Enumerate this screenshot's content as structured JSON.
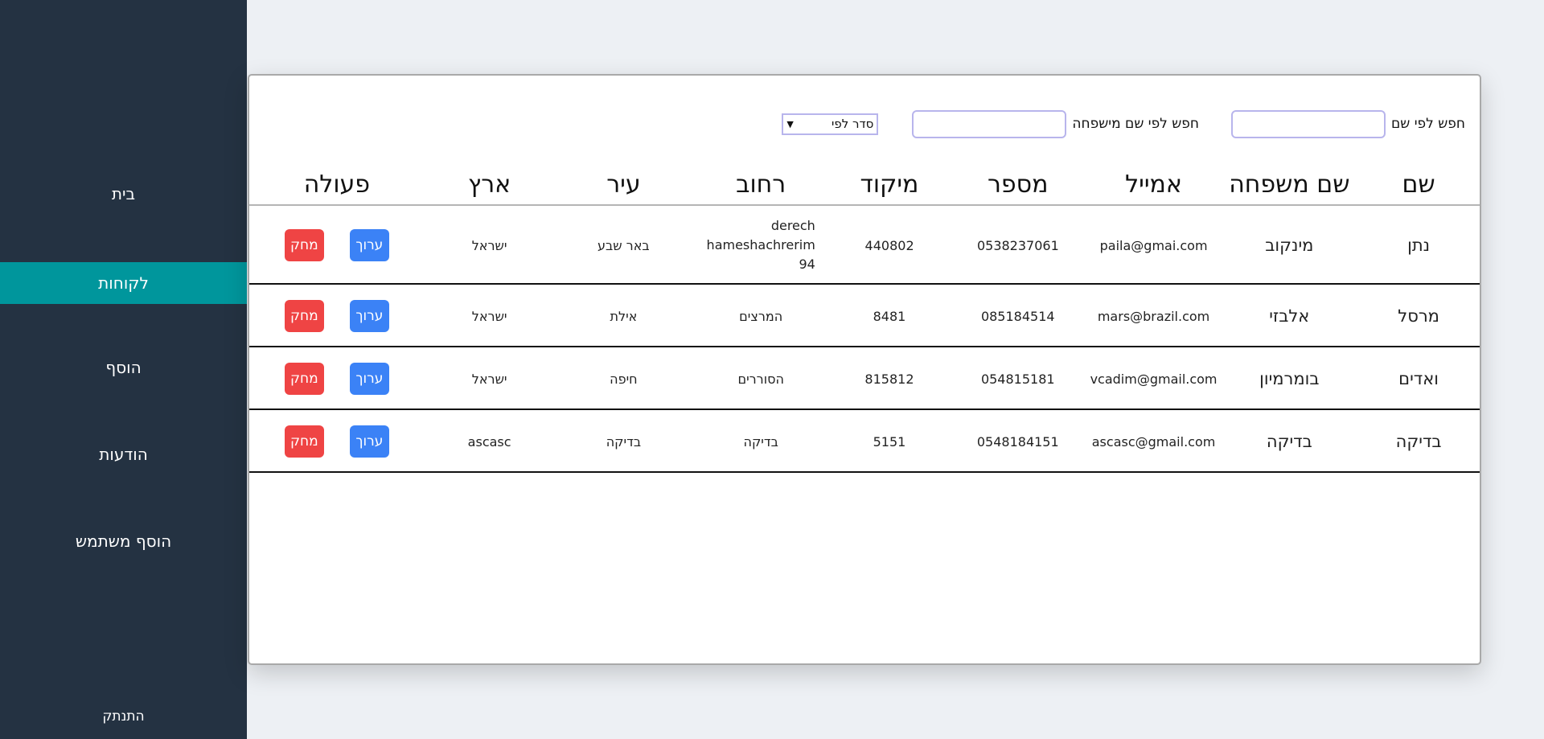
{
  "sidebar": {
    "items": [
      {
        "label": "בית"
      },
      {
        "label": "לקוחות"
      },
      {
        "label": "הוסף"
      },
      {
        "label": "הודעות"
      },
      {
        "label": "הוסף משתמש"
      }
    ],
    "active_index": 1,
    "logout_label": "התנתק"
  },
  "filters": {
    "first_name_label": "חפש לפי שם",
    "first_name_value": "",
    "last_name_label": "חפש לפי שם מישפחה",
    "last_name_value": "",
    "sort_label": "סדר לפי"
  },
  "table": {
    "headers": [
      "שם",
      "שם משפחה",
      "אמייל",
      "מספר",
      "מיקוד",
      "רחוב",
      "עיר",
      "ארץ",
      "פעולה"
    ],
    "edit_label": "ערוך",
    "delete_label": "מחק",
    "rows": [
      {
        "first": "נתן",
        "last": "מינקוב",
        "email": "paila@gmai.com",
        "phone": "0538237061",
        "zip": "440802",
        "street": "derech hameshachrerim 94",
        "city": "באר שבע",
        "country": "ישראל"
      },
      {
        "first": "מרסל",
        "last": "אלבזי",
        "email": "mars@brazil.com",
        "phone": "085184514",
        "zip": "8481",
        "street": "המרצים",
        "city": "אילת",
        "country": "ישראל"
      },
      {
        "first": "ואדים",
        "last": "בומרמיון",
        "email": "vcadim@gmail.com",
        "phone": "054815181",
        "zip": "815812",
        "street": "הסוררים",
        "city": "חיפה",
        "country": "ישראל"
      },
      {
        "first": "בדיקה",
        "last": "בדיקה",
        "email": "ascasc@gmail.com",
        "phone": "0548184151",
        "zip": "5151",
        "street": "בדיקה",
        "city": "בדיקה",
        "country": "ascasc"
      }
    ]
  },
  "colors": {
    "sidebar_bg": "#243242",
    "active_item": "#00969c",
    "edit_button": "#3b82f6",
    "delete_button": "#ef4444"
  }
}
